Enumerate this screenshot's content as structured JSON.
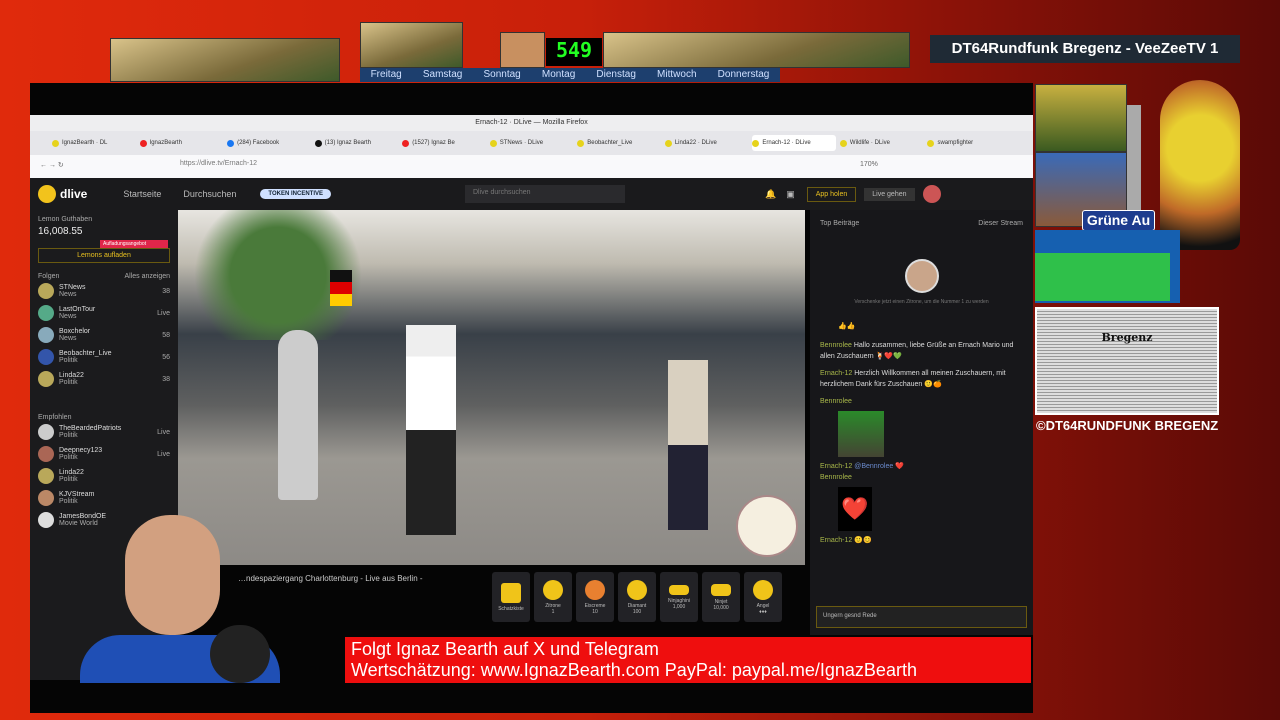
{
  "overlay": {
    "channel_title": "DT64Rundfunk Bregenz - VeeZeeTV 1",
    "clock_counter": "549",
    "days": [
      "Freitag",
      "Samstag",
      "Sonntag",
      "Montag",
      "Dienstag",
      "Mittwoch",
      "Donnerstag"
    ],
    "sign": "Grüne Au",
    "engraving_label": "Bregenz",
    "copyright": "©DT64RUNDFUNK BREGENZ"
  },
  "browser": {
    "window_title": "Ernach-12 · DLive — Mozilla Firefox",
    "tabs": [
      "IgnazBearth · DL",
      "IgnazBearth",
      "(284) Facebook",
      "(13) Ignaz Bearth",
      "(1527) Ignaz Be",
      "STNews · DLive",
      "Beobachter_Live",
      "Linda22 · DLive",
      "Ernach-12 · DLive",
      "Wildlife · DLive",
      "swampfighter"
    ],
    "url": "https://dlive.tv/Ernach-12",
    "zoom": "170%"
  },
  "dlive": {
    "logo": "dlive",
    "nav": [
      "Startseite",
      "Durchsuchen"
    ],
    "token_badge": "TOKEN INCENTIVE",
    "search_placeholder": "Dlive durchsuchen",
    "app_button": "App holen",
    "go_live": "Live gehen"
  },
  "sidebar": {
    "balance_label": "Lemon Guthaben",
    "balance": "16,008.55",
    "bonus_badge": "Aufladungsangebot",
    "recharge_button": "Lemons aufladen",
    "following_label": "Folgen",
    "show_all": "Alles anzeigen",
    "following": [
      {
        "name": "STNews",
        "cat": "News",
        "status": "38"
      },
      {
        "name": "LastOnTour",
        "cat": "News",
        "status": "Live"
      },
      {
        "name": "Boxchelor",
        "cat": "News",
        "status": "58"
      },
      {
        "name": "Beobachter_Live",
        "cat": "Politik",
        "status": "56"
      },
      {
        "name": "Linda22",
        "cat": "Politik",
        "status": "38"
      }
    ],
    "recommended_label": "Empfohlen",
    "recommended": [
      {
        "name": "TheBeardedPatriots",
        "cat": "Politik",
        "status": "Live"
      },
      {
        "name": "Deepnecy123",
        "cat": "Politik",
        "status": "Live"
      },
      {
        "name": "Linda22",
        "cat": "Politik",
        "status": ""
      },
      {
        "name": "KJVStream",
        "cat": "Politik",
        "status": ""
      },
      {
        "name": "JamesBondOE",
        "cat": "Movie World",
        "status": ""
      }
    ]
  },
  "stream": {
    "title": "…ndespaziergang Charlottenburg - Live aus Berlin -",
    "gifts": [
      {
        "name": "Schatzkiste",
        "price": ""
      },
      {
        "name": "Zitrone",
        "price": "1"
      },
      {
        "name": "Eiscreme",
        "price": "10"
      },
      {
        "name": "Diamant",
        "price": "100"
      },
      {
        "name": "Ninjaghini",
        "price": "1,000"
      },
      {
        "name": "Ninjet",
        "price": "10,000"
      },
      {
        "name": "Angel",
        "price": "♦♦♦"
      }
    ]
  },
  "chat": {
    "header": "Top Beiträge",
    "filter": "Dieser Stream",
    "top_text": "Verschenke jetzt einen Zitrone, um die Nummer 1 zu werden",
    "messages": [
      {
        "user": "",
        "text": "👍👍"
      },
      {
        "user": "Bennrolee",
        "text": "Hallo zusammen, liebe Grüße an Ernach Mario und allen Zuschauern 🍹❤️💚"
      },
      {
        "user": "Ernach-12",
        "text": "Herzlich Willkommen all meinen Zuschauern, mit herzlichem Dank fürs Zuschauen 🙂🍊"
      },
      {
        "user": "Bennrolee",
        "text": "[GIF]"
      },
      {
        "user": "Ernach-12",
        "text": "@Bennrolee ❤️"
      },
      {
        "user": "Bennrolee",
        "text": "❤️"
      },
      {
        "user": "Ernach-12",
        "text": "🙂😊"
      }
    ],
    "input_placeholder": "Ungern gesnd Rede"
  },
  "ticker": {
    "line1": "Folgt Ignaz Bearth auf X und Telegram",
    "line2": "Wertschätzung: www.IgnazBearth.com PayPal: paypal.me/IgnazBearth"
  }
}
